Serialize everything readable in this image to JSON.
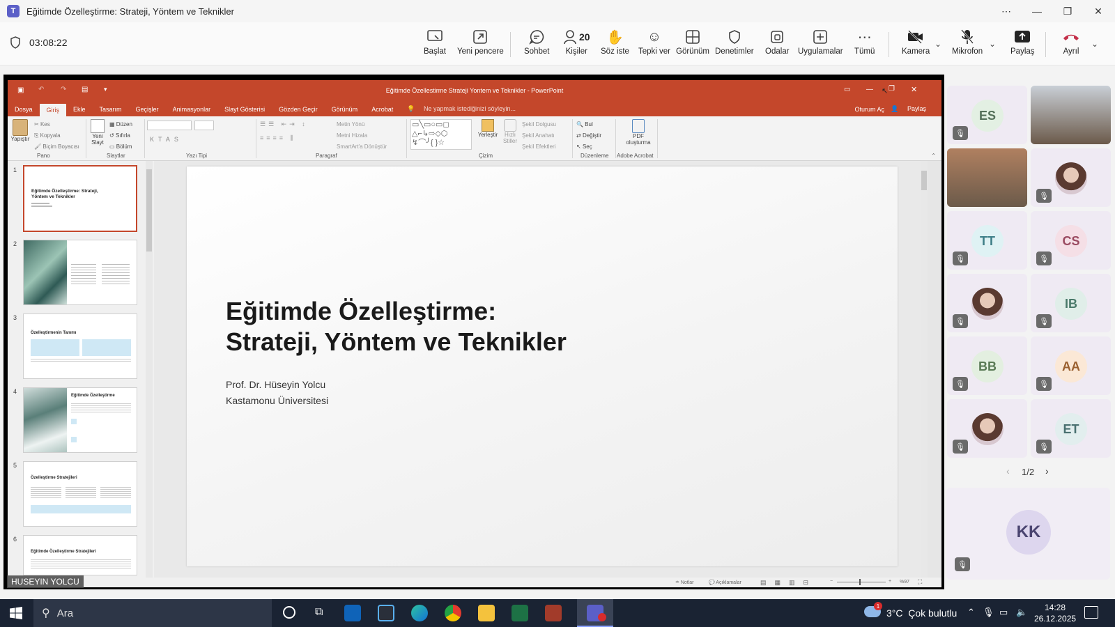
{
  "window": {
    "title": "Eğitimde Özelleştirme: Strateji, Yöntem ve Teknikler",
    "icons": [
      "teams-icon",
      "more-icon",
      "minimize-icon",
      "maximize-icon",
      "close-icon"
    ]
  },
  "meeting": {
    "timer": "03:08:22",
    "toolbar": {
      "start": "Başlat",
      "new_window": "Yeni pencere",
      "chat": "Sohbet",
      "people_count": "20",
      "people": "Kişiler",
      "raise_hand": "Söz iste",
      "react": "Tepki ver",
      "view": "Görünüm",
      "controls": "Denetimler",
      "rooms": "Odalar",
      "apps": "Uygulamalar",
      "more": "Tümü",
      "camera": "Kamera",
      "mic": "Mikrofon",
      "share": "Paylaş",
      "leave": "Ayrıl"
    },
    "colors": {
      "leave": "#c4314b",
      "accent": "#5b5fc7"
    }
  },
  "ppt": {
    "title": "Eğitimde Özellestirme Strateji Yontem ve Teknikler - PowerPoint",
    "tabs": [
      "Dosya",
      "Giriş",
      "Ekle",
      "Tasarım",
      "Geçişler",
      "Animasyonlar",
      "Slayt Gösterisi",
      "Gözden Geçir",
      "Görünüm",
      "Acrobat"
    ],
    "tell_me": "Ne yapmak istediğinizi söyleyin...",
    "sign_in": "Oturum Aç",
    "share": "Paylaş",
    "ribbon": {
      "paste": "Yapıştır",
      "cut": "Kes",
      "copy": "Kopyala",
      "format_painter": "Biçim Boyacısı",
      "clipboard": "Pano",
      "new_slide_1": "Yeni",
      "new_slide_2": "Slayt",
      "layout": "Düzen",
      "reset": "Sıfırla",
      "section": "Bölüm",
      "slides": "Slaytlar",
      "font": "Yazı Tipi",
      "text_dir": "Metin Yönü",
      "align_text": "Metni Hizala",
      "smartart": "SmartArt'a Dönüştür",
      "paragraph": "Paragraf",
      "arrange": "Yerleştir",
      "quick_styles_1": "Hızlı",
      "quick_styles_2": "Stiller",
      "shape_fill": "Şekil Dolgusu",
      "shape_outline": "Şekil Anahatı",
      "shape_effects": "Şekil Efektleri",
      "drawing": "Çizim",
      "find": "Bul",
      "replace": "Değiştir",
      "select": "Seç",
      "editing": "Düzenleme",
      "pdf_1": "PDF",
      "pdf_2": "oluşturma",
      "acrobat": "Adobe Acrobat"
    },
    "thumbs": [
      {
        "num": "1",
        "title": "Eğitimde Özelleştirme: Strateji, Yöntem ve Teknikler"
      },
      {
        "num": "2",
        "title": ""
      },
      {
        "num": "3",
        "title": "Özelleştirmenin Tanımı"
      },
      {
        "num": "4",
        "title": "Eğitimde Özelleştirme"
      },
      {
        "num": "5",
        "title": "Özelleştirme Stratejileri"
      },
      {
        "num": "6",
        "title": "Eğitimde Özelleştirme Stratejileri"
      }
    ],
    "slide": {
      "title_line1": "Eğitimde Özelleştirme:",
      "title_line2": "Strateji, Yöntem ve Teknikler",
      "author": "Prof. Dr. Hüseyin Yolcu",
      "institution": "Kastamonu Üniversitesi"
    },
    "status": {
      "notes": "Notlar",
      "comments": "Açıklamalar",
      "zoom": "%97"
    }
  },
  "presenter_name": "HUSEYIN YOLCU",
  "gallery": {
    "participants": [
      {
        "initials": "ES",
        "bg": "#e3f0e3",
        "fg": "#55705a",
        "muted": true
      },
      {
        "initials": "",
        "bg": "#c9cfd6",
        "fg": "#333",
        "muted": false,
        "video": true
      },
      {
        "initials": "",
        "bg": "#b08060",
        "fg": "#333",
        "muted": false,
        "video": true
      },
      {
        "initials": "",
        "bg": "#dde7ea",
        "fg": "#333",
        "muted": true,
        "photo": true
      },
      {
        "initials": "TT",
        "bg": "#dff2f4",
        "fg": "#3f7f88",
        "muted": true
      },
      {
        "initials": "CS",
        "bg": "#f5dfe6",
        "fg": "#9a4a60",
        "muted": true
      },
      {
        "initials": "",
        "bg": "#f0e3ea",
        "fg": "#333",
        "muted": true,
        "photo": true
      },
      {
        "initials": "IB",
        "bg": "#e0eee9",
        "fg": "#4a7a6a",
        "muted": true
      },
      {
        "initials": "BB",
        "bg": "#e3efe0",
        "fg": "#5a7a55",
        "muted": true
      },
      {
        "initials": "AA",
        "bg": "#fbe8d6",
        "fg": "#9a6030",
        "muted": true
      },
      {
        "initials": "",
        "bg": "#ece6ef",
        "fg": "#333",
        "muted": true,
        "photo": true
      },
      {
        "initials": "ET",
        "bg": "#e2eeee",
        "fg": "#4a7070",
        "muted": true
      }
    ],
    "page": "1/2",
    "self": {
      "initials": "KK"
    }
  },
  "taskbar": {
    "search": "Ara",
    "weather": "3°C  Çok bulutlu",
    "weather_badge": "1",
    "time": "14:28",
    "date": "26.12.2025"
  }
}
